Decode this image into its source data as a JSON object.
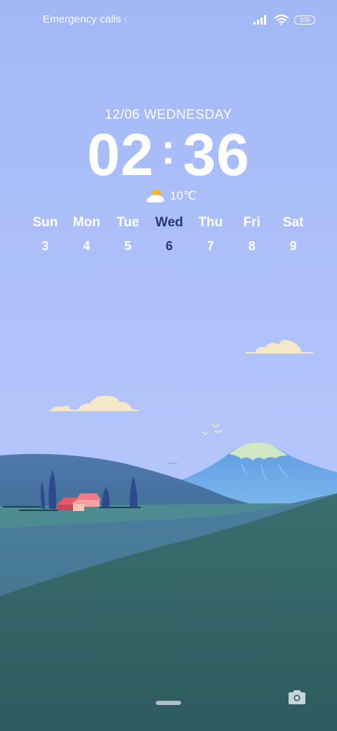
{
  "status_bar": {
    "carrier_text": "Emergency calls only",
    "battery_level": "100",
    "signal_icon": "signal-bars-icon",
    "wifi_icon": "wifi-icon"
  },
  "lockscreen": {
    "date": "12/06 WEDNESDAY",
    "clock_hours": "02",
    "clock_minutes": "36",
    "weather_icon": "partly-cloudy-icon",
    "temperature": "10℃",
    "week": [
      {
        "name": "Sun",
        "number": "3"
      },
      {
        "name": "Mon",
        "number": "4"
      },
      {
        "name": "Tue",
        "number": "5"
      },
      {
        "name": "Wed",
        "number": "6"
      },
      {
        "name": "Thu",
        "number": "7"
      },
      {
        "name": "Fri",
        "number": "8"
      },
      {
        "name": "Sat",
        "number": "9"
      }
    ],
    "current_day_index": 3
  },
  "bottom": {
    "camera_icon": "camera-icon",
    "home_indicator": "home-indicator"
  },
  "colors": {
    "sky_top": "#a3b9f6",
    "sky_bottom": "#b5c6fb",
    "today_highlight": "#243a6e",
    "hill_front": "#2f5f62",
    "mountain": "#6aa6e8"
  }
}
